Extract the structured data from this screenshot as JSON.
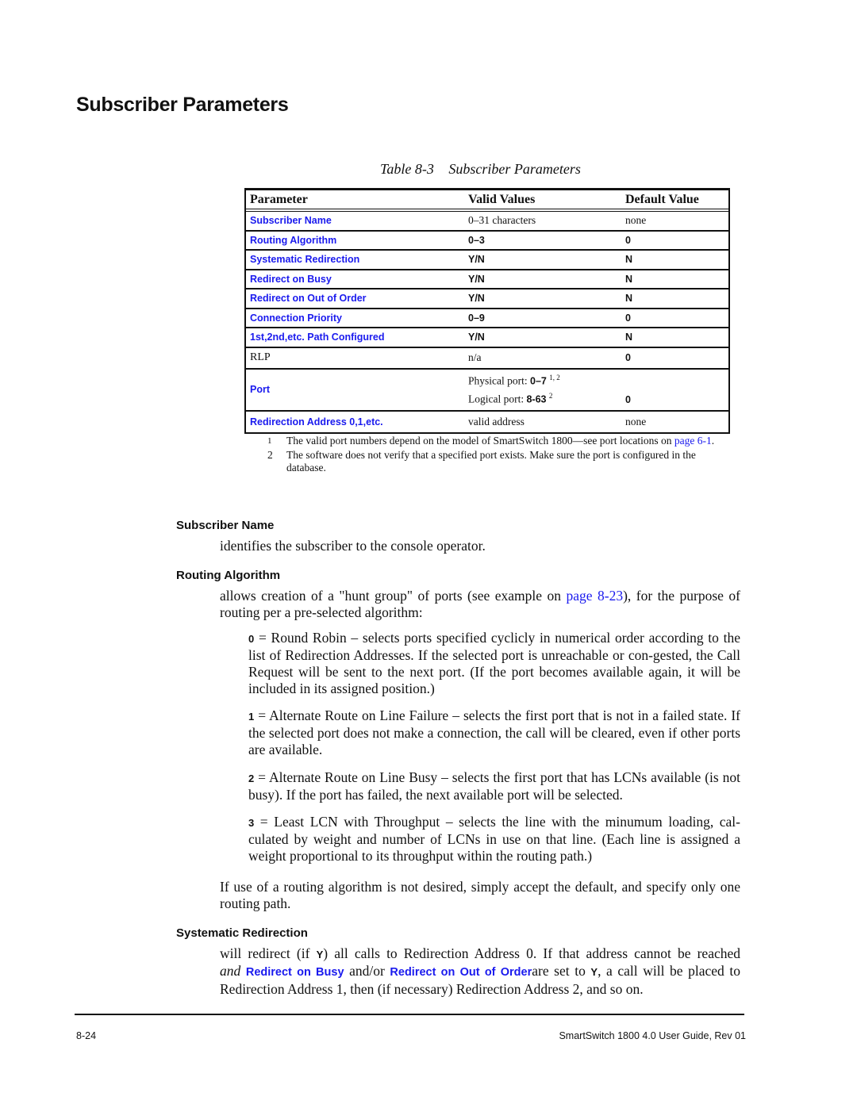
{
  "page": {
    "title": "Subscriber Parameters"
  },
  "table": {
    "caption_number": "Table 8-3",
    "caption_title": "Subscriber Parameters",
    "headers": [
      "Parameter",
      "Valid Values",
      "Default Value"
    ],
    "rows": [
      {
        "parameter": "Subscriber Name",
        "valid": "0–31 characters",
        "default": "none",
        "link": true
      },
      {
        "parameter": "Routing Algorithm",
        "valid": "0–3",
        "default": "0",
        "link": true
      },
      {
        "parameter": "Systematic Redirection",
        "valid": "Y/N",
        "default": "N",
        "link": true
      },
      {
        "parameter": "Redirect on Busy",
        "valid": "Y/N",
        "default": "N",
        "link": true
      },
      {
        "parameter": "Redirect on Out of Order",
        "valid": "Y/N",
        "default": "N",
        "link": true
      },
      {
        "parameter": "Connection Priority",
        "valid": "0–9",
        "default": "0",
        "link": true
      },
      {
        "parameter": "1st,2nd,etc. Path Configured",
        "valid": "Y/N",
        "default": "N",
        "link": true
      },
      {
        "parameter": "RLP",
        "valid": "n/a",
        "default": "0",
        "link": false
      }
    ],
    "port_row": {
      "parameter": "Port",
      "physical_label": "Physical port: ",
      "physical_value": "0–7",
      "physical_sup": "1, 2",
      "logical_label": "Logical port: ",
      "logical_value": "8-63",
      "logical_sup": "2",
      "default": "0"
    },
    "last_row": {
      "parameter": "Redirection Address 0,1,etc.",
      "valid": "valid address",
      "default": "none"
    }
  },
  "footnotes": [
    {
      "num": "1",
      "text_before": "The valid port numbers depend on the model of SmartSwitch 1800—see port locations on ",
      "link": "page 6-1",
      "text_after": "."
    },
    {
      "num": "2",
      "text_before": "The software does not verify that a specified port exists. Make sure the port is configured in the database.",
      "link": "",
      "text_after": ""
    }
  ],
  "sections": {
    "subscriber_name": {
      "heading": "Subscriber Name",
      "text": "identifies the subscriber to the console operator."
    },
    "routing_algorithm": {
      "heading": "Routing Algorithm",
      "intro_before": "allows creation of a \"hunt group\" of ports (see example on ",
      "intro_link": "page 8-23",
      "intro_after": "), for the purpose of routing per a pre-selected algorithm:",
      "options": [
        {
          "key": "0",
          "text": " = Round Robin – selects ports specified cyclicly in numerical order according to the list of Redirection Addresses. If the selected port is unreachable or con-gested, the Call Request will be sent to the next port. (If the port becomes available again, it will be included in its assigned position.)"
        },
        {
          "key": "1",
          "text": " = Alternate Route on Line Failure – selects the first port that is not in a failed state. If the selected port does not make a connection, the call will be cleared, even if other ports are available."
        },
        {
          "key": "2",
          "text": " = Alternate Route on Line Busy – selects the first port that has LCNs available (is not busy). If the port has failed, the next available port will be selected."
        },
        {
          "key": "3",
          "text": " = Least LCN with Throughput – selects the line with the minumum loading, cal-culated by weight and number of LCNs in use on that line. (Each line is assigned a weight proportional to its throughput within the routing path.)"
        }
      ],
      "closing": "If use of a routing algorithm is not desired, simply accept the default, and specify only one routing path."
    },
    "systematic_redirection": {
      "heading": "Systematic Redirection",
      "t1": "will redirect (if ",
      "k1": "Y",
      "t2": ") all calls to Redirection Address 0. If that address cannot be reached ",
      "t3": "and",
      "link1": "Redirect on Busy",
      "t4": " and/or ",
      "link2": "Redirect on Out of Order",
      "t5": "are set to ",
      "k2": "Y",
      "t6": ",  a call will be placed to Redirection Address 1, then (if necessary) Redirection Address 2, and so on."
    }
  },
  "footer": {
    "page_number": "8-24",
    "guide_title": "SmartSwitch 1800 4.0 User Guide, Rev 01"
  },
  "colors": {
    "link": "#1a1aee",
    "text": "#111111"
  }
}
